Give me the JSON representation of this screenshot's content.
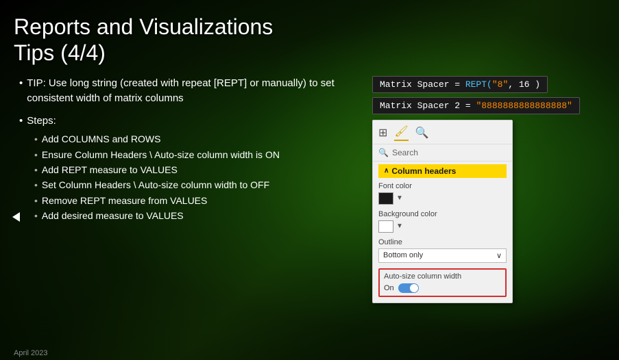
{
  "title": {
    "line1": "Reports and Visualizations",
    "line2": "Tips (4/4)"
  },
  "tip": {
    "bullet": "TIP: Use long string (created with repeat [REPT] or manually) to set consistent width of matrix columns"
  },
  "steps": {
    "label": "Steps:",
    "items": [
      "Add COLUMNS and ROWS",
      "Ensure Column Headers \\ Auto-size column width is ON",
      "Add REPT measure to VALUES",
      "Set Column Headers \\ Auto-size column width to OFF",
      "Remove REPT measure from VALUES",
      "Add desired measure to VALUES"
    ]
  },
  "formula1": {
    "prefix": "Matrix Spacer = ",
    "func": "REPT(",
    "str": "\"8\"",
    "sep": ", 16",
    "close": " )"
  },
  "formula2": {
    "prefix": "Matrix Spacer 2 = ",
    "str": "\"8888888888888888\""
  },
  "panel": {
    "toolbar_icons": [
      "table-icon",
      "format-icon",
      "analytics-icon"
    ],
    "search_placeholder": "Search",
    "section_label": "Column headers",
    "font_color_label": "Font color",
    "bg_color_label": "Background color",
    "outline_label": "Outline",
    "outline_value": "Bottom only",
    "auto_size_label": "Auto-size column width",
    "toggle_label": "On"
  },
  "footer": {
    "text": "April 2023"
  }
}
